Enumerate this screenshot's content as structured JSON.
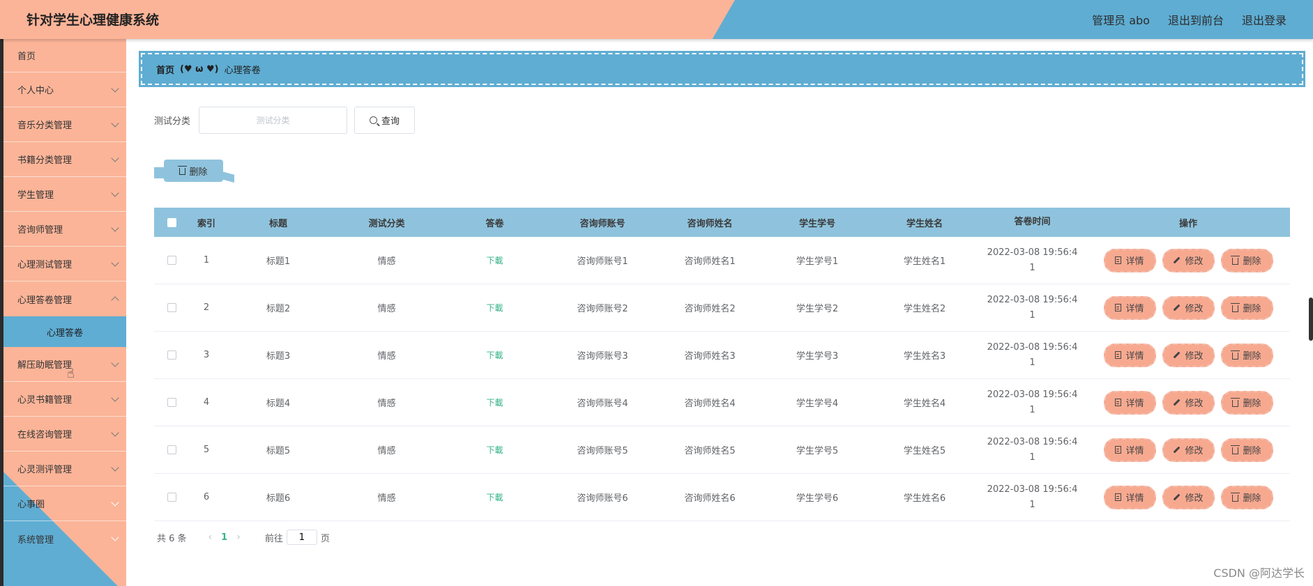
{
  "app": {
    "title": "针对学生心理健康系统"
  },
  "header": {
    "user": "管理员 abo",
    "to_front": "退出到前台",
    "logout": "退出登录"
  },
  "sidebar": {
    "items": [
      {
        "label": "首页"
      },
      {
        "label": "个人中心"
      },
      {
        "label": "音乐分类管理"
      },
      {
        "label": "书籍分类管理"
      },
      {
        "label": "学生管理"
      },
      {
        "label": "咨询师管理"
      },
      {
        "label": "心理测试管理"
      },
      {
        "label": "心理答卷管理"
      },
      {
        "label": "心理答卷"
      },
      {
        "label": "解压助眠管理"
      },
      {
        "label": "心灵书籍管理"
      },
      {
        "label": "在线咨询管理"
      },
      {
        "label": "心灵测评管理"
      },
      {
        "label": "心事圈"
      },
      {
        "label": "系统管理"
      }
    ]
  },
  "breadcrumb": {
    "home": "首页",
    "sep": "(♥ ω ♥)",
    "current": "心理答卷"
  },
  "search": {
    "label": "测试分类",
    "placeholder": "测试分类",
    "button": "查询"
  },
  "toolbar": {
    "delete_label": "删除"
  },
  "table": {
    "headers": {
      "index": "索引",
      "title": "标题",
      "category": "测试分类",
      "answer": "答卷",
      "account": "咨询师账号",
      "counselor": "咨询师姓名",
      "student_no": "学生学号",
      "student_name": "学生姓名",
      "time": "答卷时间",
      "ops": "操作"
    },
    "rows": [
      {
        "index": "1",
        "title": "标题1",
        "category": "情感",
        "answer": "下載",
        "account": "咨询师账号1",
        "counselor": "咨询师姓名1",
        "student_no": "学生学号1",
        "student_name": "学生姓名1",
        "time_a": "2022-03-08 19:56:4",
        "time_b": "1"
      },
      {
        "index": "2",
        "title": "标题2",
        "category": "情感",
        "answer": "下載",
        "account": "咨询师账号2",
        "counselor": "咨询师姓名2",
        "student_no": "学生学号2",
        "student_name": "学生姓名2",
        "time_a": "2022-03-08 19:56:4",
        "time_b": "1"
      },
      {
        "index": "3",
        "title": "标题3",
        "category": "情感",
        "answer": "下載",
        "account": "咨询师账号3",
        "counselor": "咨询师姓名3",
        "student_no": "学生学号3",
        "student_name": "学生姓名3",
        "time_a": "2022-03-08 19:56:4",
        "time_b": "1"
      },
      {
        "index": "4",
        "title": "标题4",
        "category": "情感",
        "answer": "下載",
        "account": "咨询师账号4",
        "counselor": "咨询师姓名4",
        "student_no": "学生学号4",
        "student_name": "学生姓名4",
        "time_a": "2022-03-08 19:56:4",
        "time_b": "1"
      },
      {
        "index": "5",
        "title": "标题5",
        "category": "情感",
        "answer": "下載",
        "account": "咨询师账号5",
        "counselor": "咨询师姓名5",
        "student_no": "学生学号5",
        "student_name": "学生姓名5",
        "time_a": "2022-03-08 19:56:4",
        "time_b": "1"
      },
      {
        "index": "6",
        "title": "标题6",
        "category": "情感",
        "answer": "下載",
        "account": "咨询师账号6",
        "counselor": "咨询师姓名6",
        "student_no": "学生学号6",
        "student_name": "学生姓名6",
        "time_a": "2022-03-08 19:56:4",
        "time_b": "1"
      }
    ],
    "ops": {
      "detail": "详情",
      "edit": "修改",
      "delete": "删除"
    }
  },
  "pagination": {
    "total": "共 6 条",
    "current": "1",
    "goto": "前往",
    "page_value": "1",
    "page_suffix": "页"
  },
  "watermark": "CSDN @阿达学长",
  "colors": {
    "peach": "#fbb498",
    "blue": "#5fadd3",
    "table_header": "#8fc3dd",
    "op_button": "#f7a990",
    "link_green": "#36b38a"
  }
}
